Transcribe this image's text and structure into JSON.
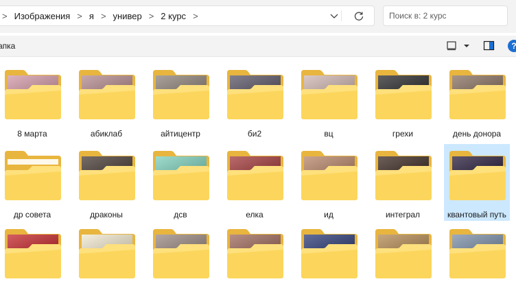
{
  "address_bar": {
    "crumbs": [
      "Изображения",
      "я",
      "универ",
      "2 курс"
    ]
  },
  "search": {
    "placeholder": "Поиск в: 2 курс"
  },
  "command_bar": {
    "new_label": "апка"
  },
  "help": {
    "label": "?"
  },
  "folders": [
    {
      "name": "8 марта",
      "thumb": "#d49aa8",
      "selected": false
    },
    {
      "name": "абиклаб",
      "thumb": "#b58b8e",
      "selected": false
    },
    {
      "name": "айтицентр",
      "thumb": "#8f847a",
      "selected": false
    },
    {
      "name": "би2",
      "thumb": "#5b5566",
      "selected": false
    },
    {
      "name": "вц",
      "thumb": "#d0b7b3",
      "selected": false
    },
    {
      "name": "грехи",
      "thumb": "#2b2b2d",
      "selected": false
    },
    {
      "name": "день донора",
      "thumb": "#8a7262",
      "selected": false
    },
    {
      "name": "др совета",
      "thumb": "",
      "selected": false
    },
    {
      "name": "драконы",
      "thumb": "#4a3d36",
      "selected": false
    },
    {
      "name": "дсв",
      "thumb": "#7fd1bd",
      "selected": false
    },
    {
      "name": "елка",
      "thumb": "#a33a3a",
      "selected": false
    },
    {
      "name": "ид",
      "thumb": "#b8866a",
      "selected": false
    },
    {
      "name": "интеграл",
      "thumb": "#3d2a22",
      "selected": false
    },
    {
      "name": "квантовый путь",
      "thumb": "#2a1f3d",
      "selected": true
    },
    {
      "name": "",
      "thumb": "#c5282b",
      "selected": false
    },
    {
      "name": "",
      "thumb": "#f1e9d0",
      "selected": false
    },
    {
      "name": "",
      "thumb": "#9b8a82",
      "selected": false
    },
    {
      "name": "",
      "thumb": "#9f6a5b",
      "selected": false
    },
    {
      "name": "",
      "thumb": "#2d3c78",
      "selected": false
    },
    {
      "name": "",
      "thumb": "#b58b53",
      "selected": false
    },
    {
      "name": "",
      "thumb": "#7c8fa8",
      "selected": false
    }
  ]
}
